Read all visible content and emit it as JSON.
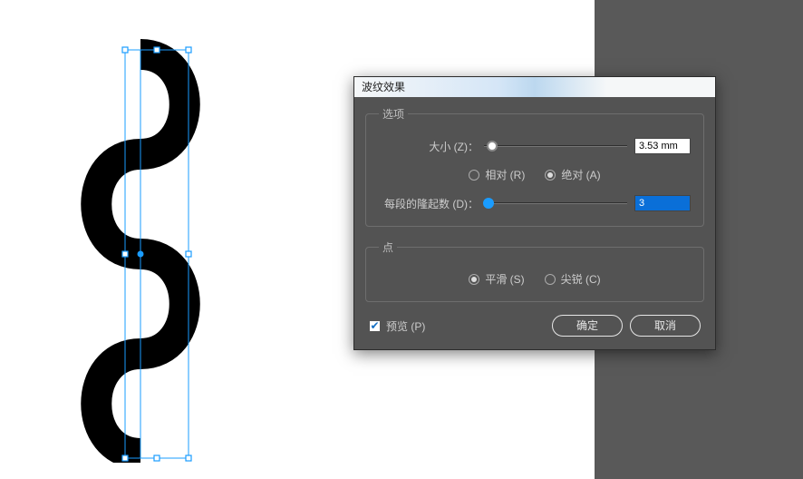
{
  "dialog": {
    "title": "波纹效果",
    "options_legend": "选项",
    "size_label": "大小 (Z)：",
    "size_value": "3.53 mm",
    "relative_label": "相对 (R)",
    "absolute_label": "绝对 (A)",
    "size_mode_selected": "absolute",
    "ridges_label": "每段的隆起数 (D)：",
    "ridges_value": "3",
    "point_legend": "点",
    "smooth_label": "平滑 (S)",
    "corner_label": "尖锐 (C)",
    "point_mode_selected": "smooth",
    "preview_label": "预览 (P)",
    "preview_checked": true,
    "ok_label": "确定",
    "cancel_label": "取消"
  }
}
